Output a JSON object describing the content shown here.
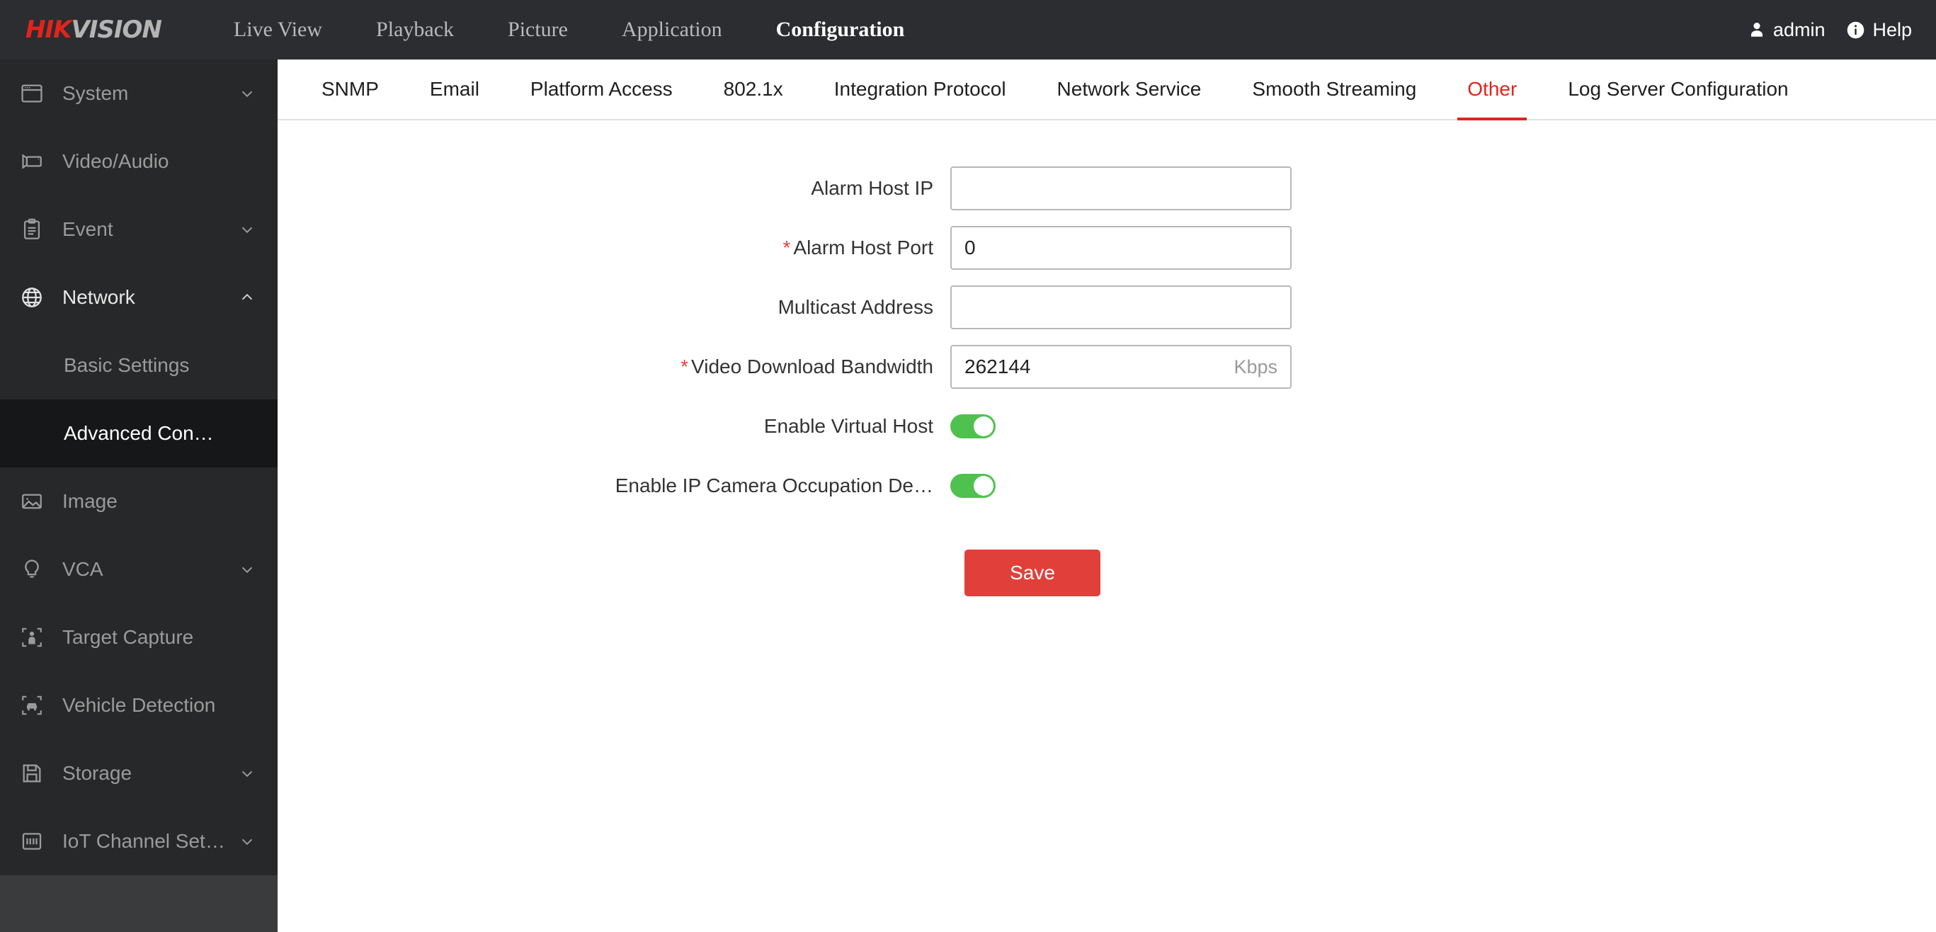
{
  "header": {
    "logo_hik": "HIK",
    "logo_vision": "VISION",
    "nav": [
      {
        "label": "Live View",
        "active": false
      },
      {
        "label": "Playback",
        "active": false
      },
      {
        "label": "Picture",
        "active": false
      },
      {
        "label": "Application",
        "active": false
      },
      {
        "label": "Configuration",
        "active": true
      }
    ],
    "user_label": "admin",
    "user_icon": "user-icon",
    "help_label": "Help",
    "help_icon": "info-circle-icon"
  },
  "sidebar": {
    "items": [
      {
        "label": "System",
        "icon": "window-icon",
        "chevron": "down",
        "selected": false
      },
      {
        "label": "Video/Audio",
        "icon": "camcorder-icon",
        "chevron": "none",
        "selected": false
      },
      {
        "label": "Event",
        "icon": "clipboard-icon",
        "chevron": "down",
        "selected": false
      },
      {
        "label": "Network",
        "icon": "globe-icon",
        "chevron": "up",
        "selected": false,
        "expanded": true
      },
      {
        "label": "Image",
        "icon": "picture-icon",
        "chevron": "none",
        "selected": false
      },
      {
        "label": "VCA",
        "icon": "bulb-icon",
        "chevron": "down",
        "selected": false
      },
      {
        "label": "Target Capture",
        "icon": "person-frame-icon",
        "chevron": "none",
        "selected": false
      },
      {
        "label": "Vehicle Detection",
        "icon": "car-frame-icon",
        "chevron": "none",
        "selected": false
      },
      {
        "label": "Storage",
        "icon": "floppy-icon",
        "chevron": "down",
        "selected": false
      },
      {
        "label": "IoT Channel Set…",
        "icon": "iot-icon",
        "chevron": "down",
        "selected": false
      }
    ],
    "network_subitems": [
      {
        "label": "Basic Settings",
        "selected": false
      },
      {
        "label": "Advanced Con…",
        "selected": true
      }
    ]
  },
  "tabs": [
    {
      "label": "SNMP",
      "active": false
    },
    {
      "label": "Email",
      "active": false
    },
    {
      "label": "Platform Access",
      "active": false
    },
    {
      "label": "802.1x",
      "active": false
    },
    {
      "label": "Integration Protocol",
      "active": false
    },
    {
      "label": "Network Service",
      "active": false
    },
    {
      "label": "Smooth Streaming",
      "active": false
    },
    {
      "label": "Other",
      "active": true
    },
    {
      "label": "Log Server Configuration",
      "active": false
    }
  ],
  "form": {
    "alarm_host_ip": {
      "label": "Alarm Host IP",
      "required": false,
      "value": "",
      "placeholder": ""
    },
    "alarm_host_port": {
      "label": "Alarm Host Port",
      "required": true,
      "value": "0",
      "placeholder": ""
    },
    "multicast_address": {
      "label": "Multicast Address",
      "required": false,
      "value": "",
      "placeholder": ""
    },
    "video_download_bandwidth": {
      "label": "Video Download Bandwidth",
      "required": true,
      "value": "262144",
      "unit": "Kbps"
    },
    "enable_virtual_host": {
      "label": "Enable Virtual Host",
      "state": "on"
    },
    "enable_ip_camera_occupation": {
      "label": "Enable IP Camera Occupation De…",
      "state": "on"
    },
    "required_marker": "*",
    "save_label": "Save"
  },
  "colors": {
    "brand_red": "#e2231a",
    "accent_red": "#e1251b",
    "save_red": "#e1403a",
    "toggle_green": "#4fc14e",
    "header_bg": "#2b2d30",
    "sidebar_bg": "#272829",
    "sidebar_selected_bg": "#161718"
  }
}
